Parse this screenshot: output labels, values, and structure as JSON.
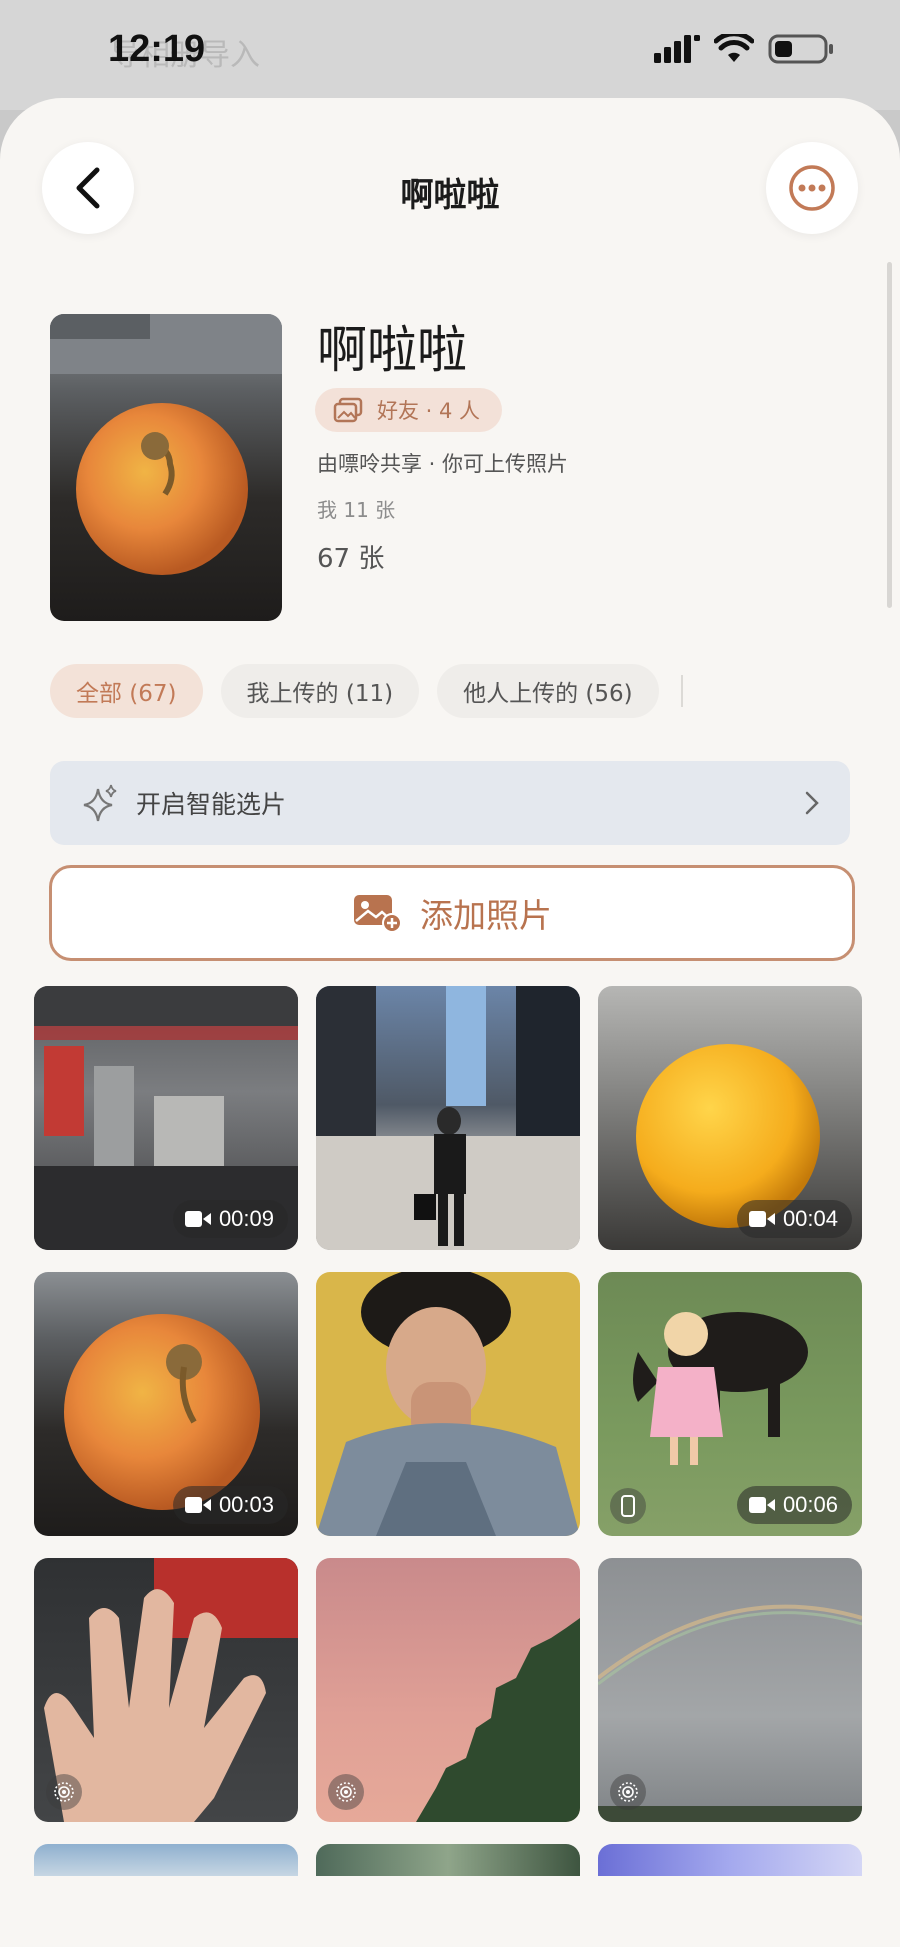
{
  "status_bar": {
    "time": "12:19"
  },
  "background": {
    "banner_text": "导相册导入"
  },
  "nav": {
    "title": "啊啦啦"
  },
  "album": {
    "name": "啊啦啦",
    "badge": "好友 · 4 人",
    "shared_by": "由嘌呤共享 · 你可上传照片",
    "my_count": "我 11 张",
    "total_count": "67 张"
  },
  "tabs": [
    {
      "label": "全部 (67)",
      "active": true
    },
    {
      "label": "我上传的 (11)",
      "active": false
    },
    {
      "label": "他人上传的 (56)",
      "active": false
    }
  ],
  "smart_select": {
    "label": "开启智能选片"
  },
  "add_button": {
    "label": "添加照片"
  },
  "photos": [
    {
      "duration": "00:09",
      "kind": "video"
    },
    {
      "duration": "",
      "kind": "photo"
    },
    {
      "duration": "00:04",
      "kind": "video"
    },
    {
      "duration": "00:03",
      "kind": "video"
    },
    {
      "duration": "",
      "kind": "photo"
    },
    {
      "duration": "00:06",
      "kind": "video",
      "badge": "phone-icon"
    },
    {
      "duration": "",
      "kind": "live",
      "badge": "live-photo-icon"
    },
    {
      "duration": "",
      "kind": "live",
      "badge": "live-photo-icon"
    },
    {
      "duration": "",
      "kind": "live",
      "badge": "live-photo-icon"
    }
  ],
  "colors": {
    "accent": "#c27a57",
    "accent_bg": "#f3e2d8",
    "sheet_bg": "#f8f6f3"
  }
}
